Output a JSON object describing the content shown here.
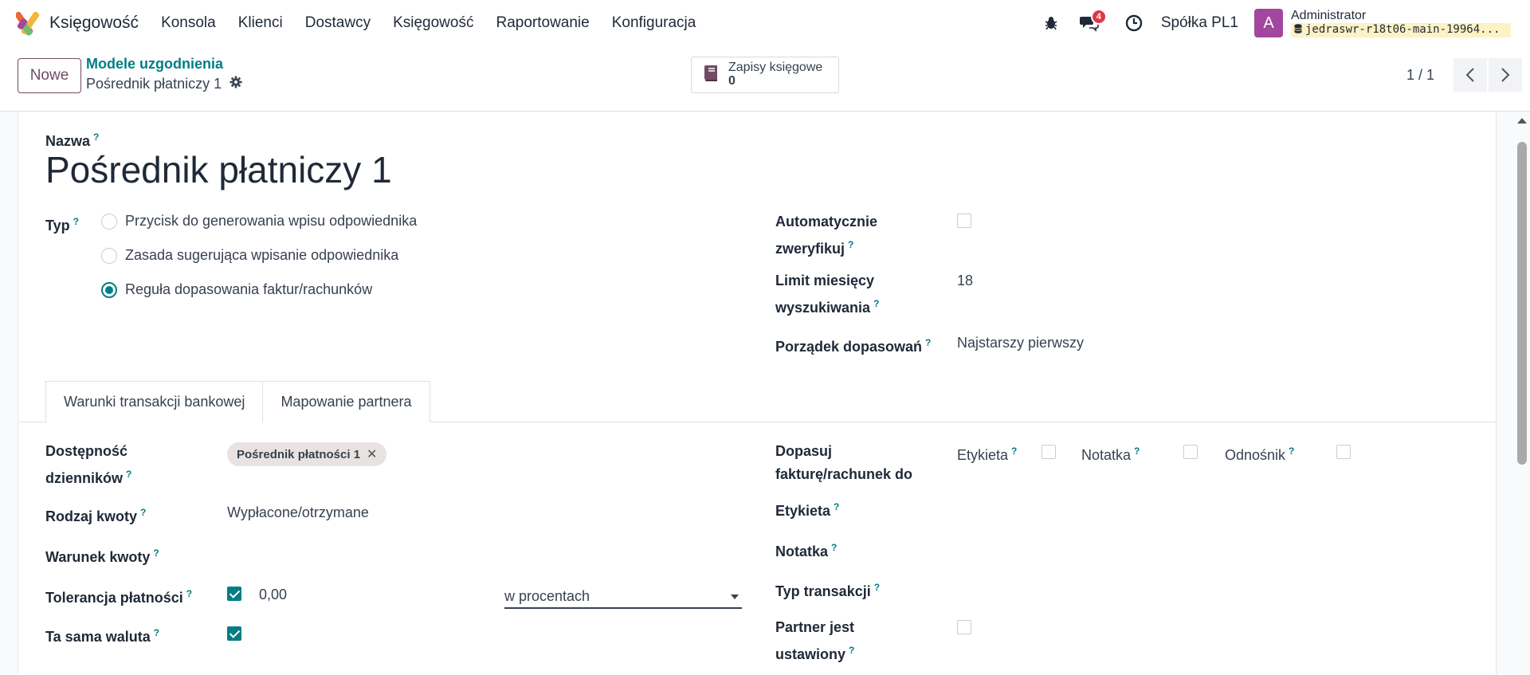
{
  "app": {
    "name": "Księgowość",
    "menu": [
      "Konsola",
      "Klienci",
      "Dostawcy",
      "Księgowość",
      "Raportowanie",
      "Konfiguracja"
    ],
    "messages_badge": "4",
    "company": "Spółka PL1",
    "user_initial": "A",
    "user_name": "Administrator",
    "db_name": "jedraswr-r18t06-main-19964..."
  },
  "control": {
    "new_button": "Nowe",
    "breadcrumb_parent": "Modele uzgodnienia",
    "breadcrumb_current": "Pośrednik płatniczy 1",
    "smart_button_label": "Zapisy księgowe",
    "smart_button_value": "0",
    "pager": "1 / 1"
  },
  "form": {
    "name_label": "Nazwa",
    "name_value": "Pośrednik płatniczy 1",
    "type_label": "Typ",
    "type_options": [
      {
        "label": "Przycisk do generowania wpisu odpowiednika",
        "checked": false
      },
      {
        "label": "Zasada sugerująca wpisanie odpowiednika",
        "checked": false
      },
      {
        "label": "Reguła dopasowania faktur/rachunków",
        "checked": true
      }
    ],
    "auto_validate_label_1": "Automatycznie",
    "auto_validate_label_2": "zweryfikuj",
    "auto_validate_checked": false,
    "search_limit_label_1": "Limit miesięcy",
    "search_limit_label_2": "wyszukiwania",
    "search_limit_value": "18",
    "matching_order_label": "Porządek dopasowań",
    "matching_order_value": "Najstarszy pierwszy",
    "help_mark": "?"
  },
  "tabs": [
    "Warunki transakcji bankowej",
    "Mapowanie partnera"
  ],
  "bank_conditions": {
    "journals_label_1": "Dostępność",
    "journals_label_2": "dzienników",
    "journal_tag": "Pośrednik płatności 1",
    "amount_type_label": "Rodzaj kwoty",
    "amount_type_value": "Wypłacone/otrzymane",
    "amount_condition_label": "Warunek kwoty",
    "tolerance_label": "Tolerancja płatności",
    "tolerance_checked": true,
    "tolerance_value": "0,00",
    "tolerance_type": "w procentach",
    "same_currency_label": "Ta sama waluta",
    "same_currency_checked": true,
    "match_invoice_label_1": "Dopasuj",
    "match_invoice_label_2": "fakturę/rachunek do",
    "match_options": [
      {
        "label": "Etykieta",
        "checked": false
      },
      {
        "label": "Notatka",
        "checked": false
      },
      {
        "label": "Odnośnik",
        "checked": false
      }
    ],
    "label_label": "Etykieta",
    "note_label": "Notatka",
    "transaction_type_label": "Typ transakcji",
    "partner_set_label_1": "Partner jest",
    "partner_set_label_2": "ustawiony",
    "partner_set_checked": false
  },
  "colors": {
    "accent": "#017e84",
    "brand": "#714b67",
    "badge": "#d93a46"
  }
}
